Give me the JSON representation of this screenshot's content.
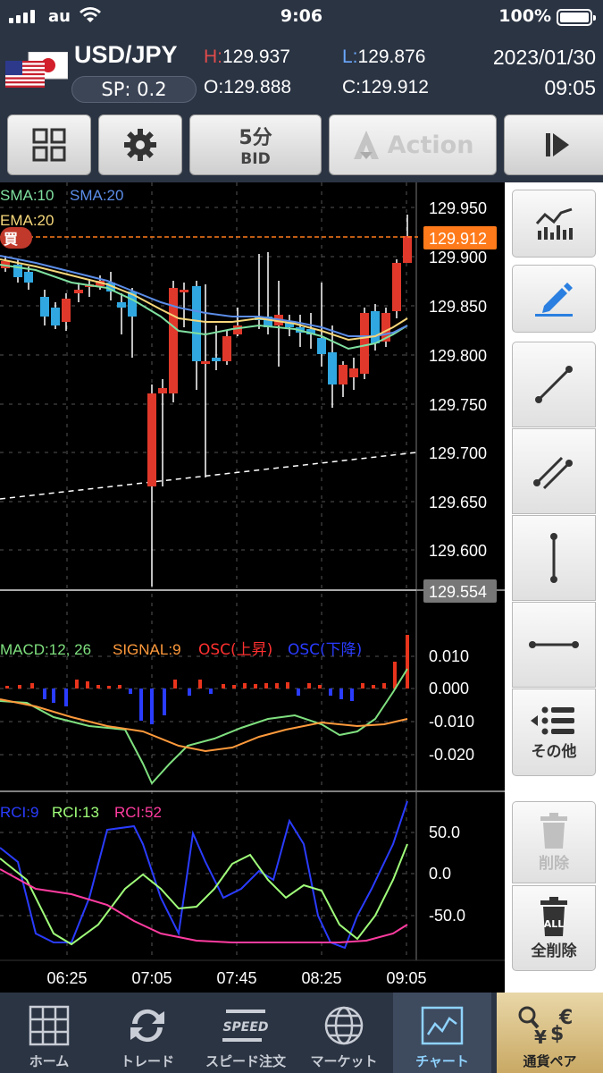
{
  "status_bar": {
    "carrier": "au",
    "time": "9:06",
    "battery": "100%"
  },
  "header": {
    "pair": "USD/JPY",
    "spread": "SP: 0.2",
    "high_label": "H:",
    "high": "129.937",
    "low_label": "L:",
    "low": "129.876",
    "open_label": "O:",
    "open": "129.888",
    "close_label": "C:",
    "close": "129.912",
    "date": "2023/01/30",
    "time": "09:05"
  },
  "toolbar": {
    "interval": "5分",
    "price_type": "BID",
    "action_label": "Action"
  },
  "chart": {
    "legend": {
      "sma10": "SMA:10",
      "sma20": "SMA:20",
      "ema20": "EMA:20"
    },
    "buy_tag": "買",
    "current_price": "129.912",
    "low_marker": "129.554",
    "price_ticks": [
      "129.950",
      "129.900",
      "129.850",
      "129.800",
      "129.750",
      "129.700",
      "129.650",
      "129.600"
    ],
    "macd": {
      "macd_label": "MACD:12, 26",
      "signal_label": "SIGNAL:9",
      "osc_up_label": "OSC(上昇)",
      "osc_down_label": "OSC(下降)",
      "ticks": [
        "0.010",
        "0.000",
        "-0.010",
        "-0.020"
      ]
    },
    "rci": {
      "rci9": "RCI:9",
      "rci13": "RCI:13",
      "rci52": "RCI:52",
      "ticks": [
        "50.0",
        "0.0",
        "-50.0"
      ]
    },
    "time_ticks": [
      "06:25",
      "07:05",
      "07:45",
      "08:25",
      "09:05"
    ],
    "colors": {
      "up": "#e0392b",
      "down": "#30a7e0",
      "sma10": "#7fe0a0",
      "sma20": "#5b8de8",
      "ema20": "#f6d77a",
      "price_line": "#ff7a1a"
    }
  },
  "tools": {
    "other": "その他",
    "delete": "削除",
    "delete_all": "全削除",
    "all_badge": "ALL"
  },
  "tabs": [
    {
      "label": "ホーム"
    },
    {
      "label": "トレード"
    },
    {
      "label": "スピード注文"
    },
    {
      "label": "マーケット"
    },
    {
      "label": "チャート"
    },
    {
      "label": "通貨ペア"
    }
  ],
  "speed_icon_text": "SPEED"
}
